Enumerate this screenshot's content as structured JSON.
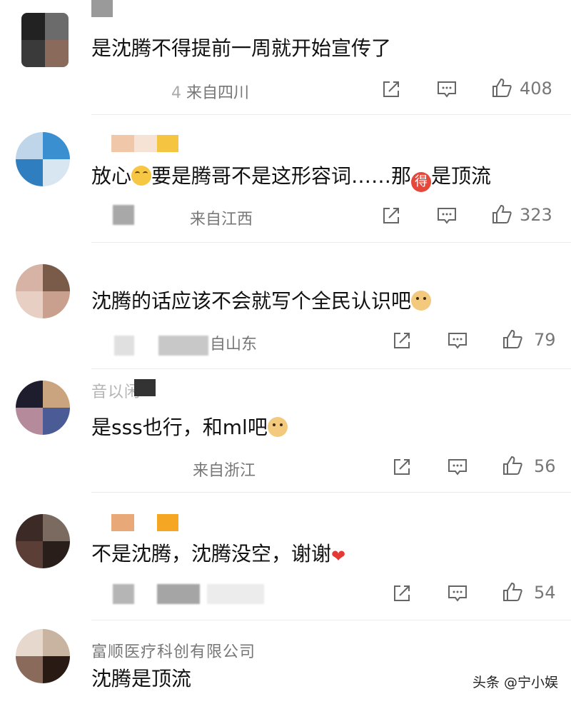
{
  "comments": [
    {
      "name": "",
      "text": "是沈腾不得提前一周就开始宣传了",
      "time": "4",
      "location": "来自四川",
      "likes": "408",
      "avatar_colors": [
        "#222222",
        "#6b6b6b",
        "#3a3a3a",
        "#8a6a5a"
      ]
    },
    {
      "name": "",
      "text_before": "放心",
      "text_mid": "要是腾哥不是这形容词……那",
      "text_after": "是顶流",
      "emoji_de": "得",
      "time": "",
      "location": "来自江西",
      "likes": "323",
      "avatar_colors": [
        "#bfd6ea",
        "#3a8fd0",
        "#2f7fc0",
        "#d8e6f2"
      ]
    },
    {
      "name": "",
      "text": "沈腾的话应该不会就写个全民认识吧",
      "time": "",
      "location": "自山东",
      "likes": "79",
      "avatar_colors": [
        "#d7b3a5",
        "#7a5a48",
        "#c9a08e",
        "#e8cfc3"
      ]
    },
    {
      "name": "音以闲",
      "text": "是sss也行，和ml吧",
      "time": "",
      "location": "来自浙江",
      "likes": "56",
      "avatar_colors": [
        "#1d1d2e",
        "#c9a47e",
        "#4b5b95",
        "#b58a9a"
      ]
    },
    {
      "name": "",
      "text": "不是沈腾，沈腾没空，谢谢",
      "time": "",
      "location": "",
      "likes": "54",
      "avatar_colors": [
        "#3b2a26",
        "#7a6a60",
        "#5b3e36",
        "#2a1e1a"
      ]
    },
    {
      "name": "富顺医疗科创有限公司",
      "text": "沈腾是顶流",
      "avatar_colors": [
        "#c8b4a0",
        "#e6d8cc",
        "#2a1a14",
        "#8a6a5a"
      ]
    }
  ],
  "watermark": "头条 @宁小娱",
  "icons": {
    "share": "share-icon",
    "comment": "comment-icon",
    "like": "thumbs-up-icon"
  },
  "colors": {
    "text": "#111111",
    "meta": "#777777",
    "divider": "#ececec",
    "heart": "#e53935"
  }
}
